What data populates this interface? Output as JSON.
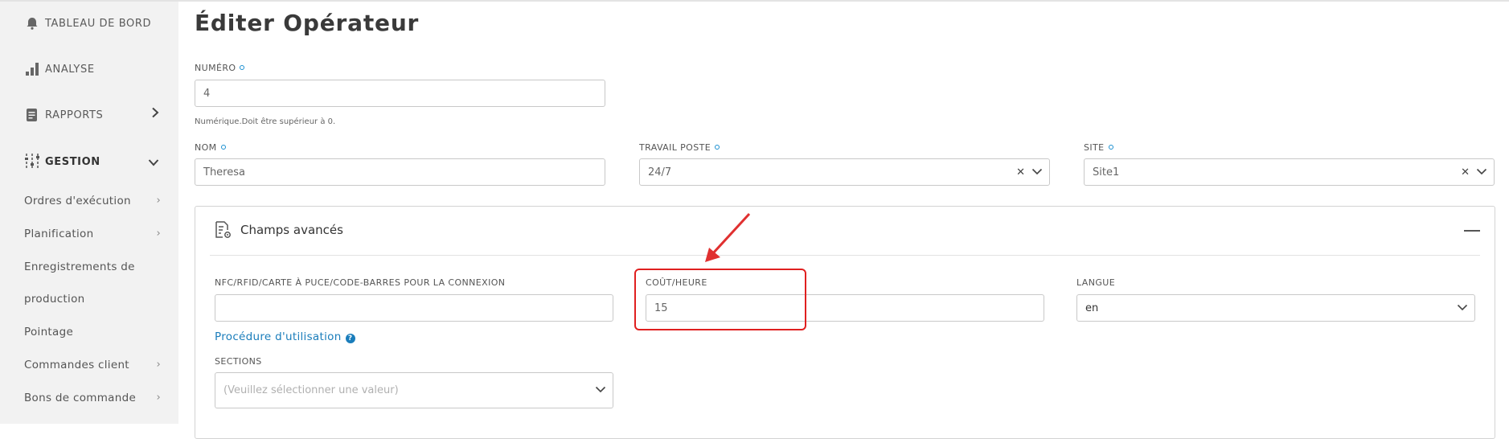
{
  "sidebar": {
    "main_items": [
      {
        "label": "TABLEAU DE BORD",
        "icon": "bell-icon"
      },
      {
        "label": "ANALYSE",
        "icon": "bar-chart-icon"
      },
      {
        "label": "RAPPORTS",
        "icon": "report-icon"
      },
      {
        "label": "GESTION",
        "icon": "sliders-icon"
      }
    ],
    "sub_items": [
      {
        "label": "Ordres d'exécution"
      },
      {
        "label": "Planification"
      },
      {
        "label": "Enregistrements de"
      },
      {
        "label": "production"
      },
      {
        "label": "Pointage"
      },
      {
        "label": "Commandes client"
      },
      {
        "label": "Bons de commande"
      }
    ]
  },
  "page": {
    "title": "Éditer Opérateur"
  },
  "form": {
    "numero": {
      "label": "NUMÉRO",
      "value": "4",
      "helper": "Numérique.Doit être supérieur à 0."
    },
    "nom": {
      "label": "NOM",
      "value": "Theresa"
    },
    "travail_poste": {
      "label": "TRAVAIL POSTE",
      "value": "24/7"
    },
    "site": {
      "label": "SITE",
      "value": "Site1"
    }
  },
  "advanced": {
    "title": "Champs avancés",
    "nfc": {
      "label": "NFC/RFID/CARTE À PUCE/CODE-BARRES POUR LA CONNEXION",
      "value": ""
    },
    "cout": {
      "label": "COÛT/HEURE",
      "value": "15"
    },
    "langue": {
      "label": "LANGUE",
      "value": "en"
    },
    "procedure_link": "Procédure d'utilisation",
    "sections": {
      "label": "SECTIONS",
      "placeholder": "(Veuillez sélectionner une valeur)"
    }
  },
  "colors": {
    "accent": "#1a7dbb",
    "annotation": "#e02020",
    "sidebar_bg": "#f2f2f2"
  }
}
